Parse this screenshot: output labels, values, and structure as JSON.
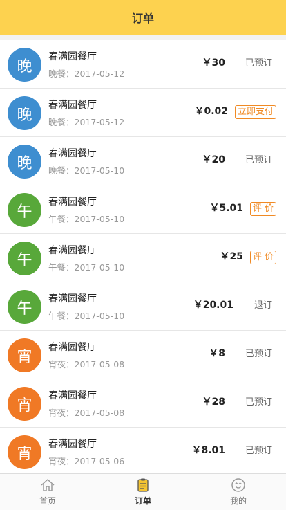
{
  "header": {
    "title": "订单"
  },
  "colors": {
    "dinner": "#3e8ed0",
    "lunch": "#58a83a",
    "midnight": "#f07925",
    "accent": "#f08a24",
    "header": "#fdd24f"
  },
  "orders": [
    {
      "avatar": "晚",
      "avatar_color": "#3e8ed0",
      "name": "春满园餐厅",
      "meal": "晚餐：2017-05-12",
      "price": "￥30",
      "status": "已预订",
      "status_type": "text"
    },
    {
      "avatar": "晚",
      "avatar_color": "#3e8ed0",
      "name": "春满园餐厅",
      "meal": "晚餐：2017-05-12",
      "price": "￥0.02",
      "status": "立即支付",
      "status_type": "button"
    },
    {
      "avatar": "晚",
      "avatar_color": "#3e8ed0",
      "name": "春满园餐厅",
      "meal": "晚餐：2017-05-10",
      "price": "￥20",
      "status": "已预订",
      "status_type": "text"
    },
    {
      "avatar": "午",
      "avatar_color": "#58a83a",
      "name": "春满园餐厅",
      "meal": "午餐：2017-05-10",
      "price": "￥5.01",
      "status": "评 价",
      "status_type": "button"
    },
    {
      "avatar": "午",
      "avatar_color": "#58a83a",
      "name": "春满园餐厅",
      "meal": "午餐：2017-05-10",
      "price": "￥25",
      "status": "评 价",
      "status_type": "button"
    },
    {
      "avatar": "午",
      "avatar_color": "#58a83a",
      "name": "春满园餐厅",
      "meal": "午餐：2017-05-10",
      "price": "￥20.01",
      "status": "退订",
      "status_type": "text"
    },
    {
      "avatar": "宵",
      "avatar_color": "#f07925",
      "name": "春满园餐厅",
      "meal": "宵夜：2017-05-08",
      "price": "￥8",
      "status": "已预订",
      "status_type": "text"
    },
    {
      "avatar": "宵",
      "avatar_color": "#f07925",
      "name": "春满园餐厅",
      "meal": "宵夜：2017-05-08",
      "price": "￥28",
      "status": "已预订",
      "status_type": "text"
    },
    {
      "avatar": "宵",
      "avatar_color": "#f07925",
      "name": "春满园餐厅",
      "meal": "宵夜：2017-05-06",
      "price": "￥8.01",
      "status": "已预订",
      "status_type": "text"
    }
  ],
  "nav": [
    {
      "label": "首页",
      "icon": "home-icon",
      "active": false
    },
    {
      "label": "订单",
      "icon": "order-icon",
      "active": true
    },
    {
      "label": "我的",
      "icon": "profile-icon",
      "active": false
    }
  ]
}
